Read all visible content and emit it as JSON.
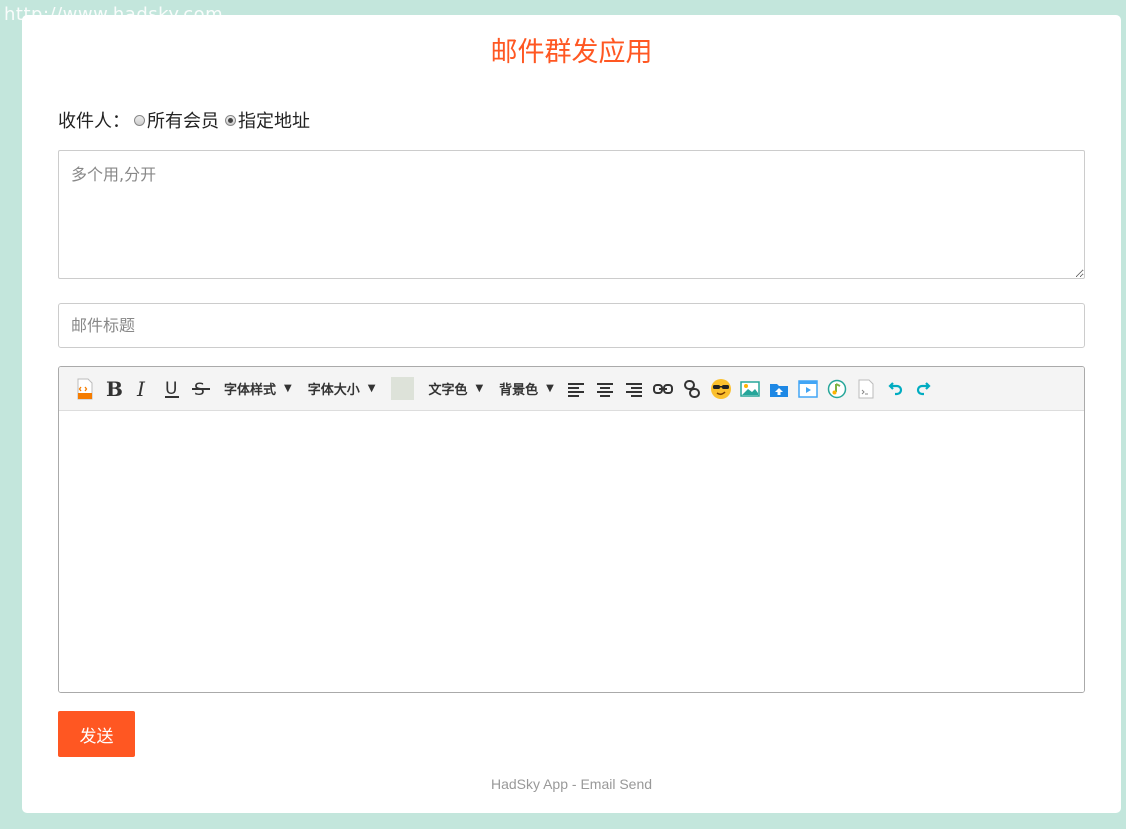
{
  "watermark": "http://www.hadsky.com",
  "page": {
    "title": "邮件群发应用",
    "accent_color": "#ff5722",
    "background_color": "#c3e6dc"
  },
  "recipients": {
    "label": "收件人：",
    "options": [
      {
        "label": "所有会员",
        "checked": false
      },
      {
        "label": "指定地址",
        "checked": true
      }
    ],
    "address_placeholder": "多个用,分开"
  },
  "subject": {
    "placeholder": "邮件标题"
  },
  "toolbar": {
    "font_style_label": "字体样式",
    "font_size_label": "字体大小",
    "text_color_label": "文字色",
    "bg_color_label": "背景色",
    "arrow": "▼",
    "icons": [
      "html-icon",
      "bold-icon",
      "italic-icon",
      "underline-icon",
      "strikethrough-icon",
      "align-left-icon",
      "align-center-icon",
      "align-right-icon",
      "link-icon",
      "unlink-icon",
      "emoji-icon",
      "image-icon",
      "upload-icon",
      "video-icon",
      "music-icon",
      "code-icon",
      "undo-icon",
      "redo-icon"
    ]
  },
  "actions": {
    "send_label": "发送"
  },
  "footer": {
    "text": "HadSky App - Email Send"
  }
}
